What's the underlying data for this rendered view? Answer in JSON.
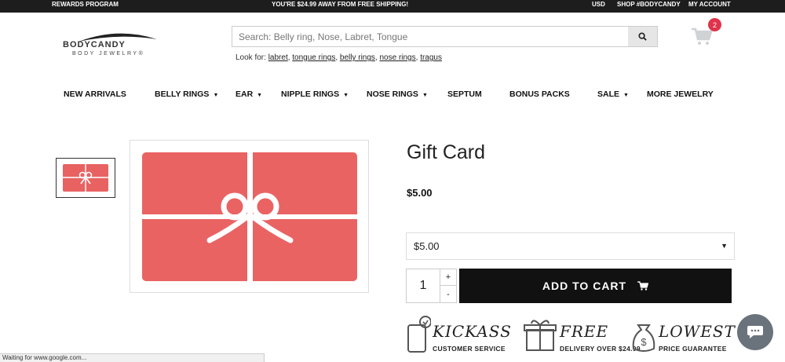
{
  "topbar": {
    "rewards": "REWARDS PROGRAM",
    "shipping": "YOU'RE $24.99 AWAY FROM FREE SHIPPING!",
    "currency": "USD",
    "shop": "SHOP #BODYCANDY",
    "account": "MY ACCOUNT"
  },
  "logo": {
    "wordmark": "BODYCANDY",
    "subtitle": "BODY JEWELRY®"
  },
  "search": {
    "placeholder": "Search: Belly ring, Nose, Labret, Tongue",
    "look_for_label": "Look for:",
    "suggestions": [
      "labret",
      "tongue rings",
      "belly rings",
      "nose rings",
      "tragus"
    ]
  },
  "cart": {
    "count": "2"
  },
  "nav": [
    {
      "label": "NEW ARRIVALS",
      "caret": ""
    },
    {
      "label": "BELLY RINGS",
      "caret": "▼"
    },
    {
      "label": "EAR",
      "caret": "▼"
    },
    {
      "label": "NIPPLE RINGS",
      "caret": "▼"
    },
    {
      "label": "NOSE RINGS",
      "caret": "▼"
    },
    {
      "label": "SEPTUM",
      "caret": ""
    },
    {
      "label": "BONUS PACKS",
      "caret": ""
    },
    {
      "label": "SALE",
      "caret": "▼"
    },
    {
      "label": "MORE JEWELRY",
      "caret": ""
    }
  ],
  "product": {
    "title": "Gift Card",
    "price": "$5.00",
    "selected_amount": "$5.00",
    "quantity": "1",
    "add_to_cart": "ADD TO CART",
    "card_color": "#ea6363"
  },
  "badges": [
    {
      "big": "KICKASS",
      "small": "CUSTOMER SERVICE",
      "icon": "phone-icon"
    },
    {
      "big": "FREE",
      "small": "DELIVERY OVER $24.99",
      "icon": "gift-box-icon"
    },
    {
      "big": "LOWEST",
      "small": "PRICE GUARANTEE",
      "icon": "money-bag-icon"
    }
  ],
  "status_bar": "Waiting for www.google.com..."
}
